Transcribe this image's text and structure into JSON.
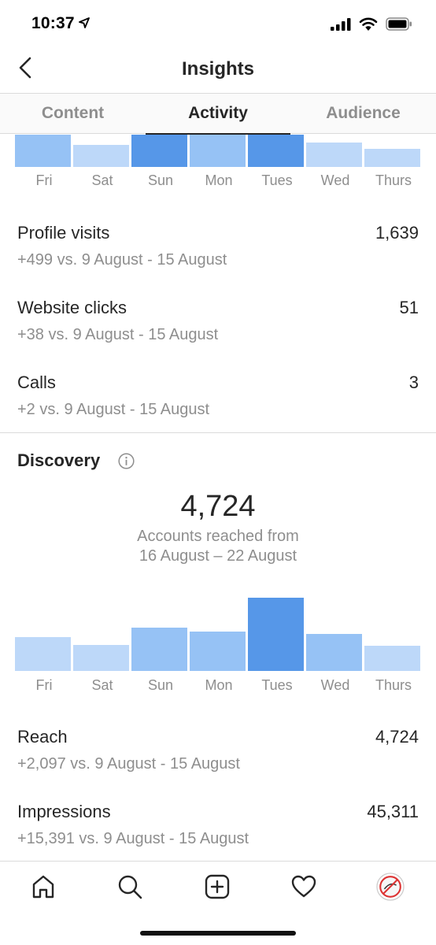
{
  "status_bar": {
    "time": "10:37",
    "icons": [
      "location-arrow-icon",
      "cellular-signal-icon",
      "wifi-icon",
      "battery-icon"
    ]
  },
  "header": {
    "title": "Insights",
    "back_icon": "chevron-left-icon"
  },
  "tabs": [
    {
      "label": "Content",
      "active": false
    },
    {
      "label": "Activity",
      "active": true
    },
    {
      "label": "Audience",
      "active": false
    }
  ],
  "colors": {
    "bar_light": "#bdd8f9",
    "bar_medium": "#96c2f5",
    "bar_dark": "#5697e8",
    "text_primary": "#262626",
    "text_secondary": "#8e8e8e"
  },
  "chart_data": [
    {
      "type": "bar",
      "categories": [
        "Fri",
        "Sat",
        "Sun",
        "Mon",
        "Tues",
        "Wed",
        "Thurs"
      ],
      "values": [
        0.77,
        0.52,
        0.77,
        0.77,
        0.77,
        0.58,
        0.42
      ],
      "shades": [
        "medium",
        "light",
        "dark",
        "medium",
        "dark",
        "light",
        "light"
      ],
      "title": "",
      "xlabel": "",
      "ylabel": ""
    },
    {
      "type": "bar",
      "categories": [
        "Fri",
        "Sat",
        "Sun",
        "Mon",
        "Tues",
        "Wed",
        "Thurs"
      ],
      "values": [
        0.46,
        0.36,
        0.59,
        0.54,
        1.0,
        0.51,
        0.34
      ],
      "shades": [
        "light",
        "light",
        "medium",
        "medium",
        "dark",
        "medium",
        "light"
      ],
      "title": "",
      "xlabel": "",
      "ylabel": ""
    }
  ],
  "activity_metrics": [
    {
      "label": "Profile visits",
      "value": "1,639",
      "comparison": "+499 vs. 9 August - 15 August"
    },
    {
      "label": "Website clicks",
      "value": "51",
      "comparison": "+38 vs. 9 August - 15 August"
    },
    {
      "label": "Calls",
      "value": "3",
      "comparison": "+2 vs. 9 August - 15 August"
    }
  ],
  "discovery": {
    "title": "Discovery",
    "info_icon": "info-icon",
    "accounts_reached": "4,724",
    "caption_line1": "Accounts reached from",
    "caption_line2": "16 August – 22 August",
    "metrics": [
      {
        "label": "Reach",
        "value": "4,724",
        "comparison": "+2,097 vs. 9 August - 15 August"
      },
      {
        "label": "Impressions",
        "value": "45,311",
        "comparison": "+15,391 vs. 9 August - 15 August"
      }
    ]
  },
  "bottom_nav": [
    {
      "icon": "home-icon"
    },
    {
      "icon": "search-icon"
    },
    {
      "icon": "add-post-icon"
    },
    {
      "icon": "heart-icon"
    },
    {
      "icon": "profile-avatar-icon"
    }
  ]
}
